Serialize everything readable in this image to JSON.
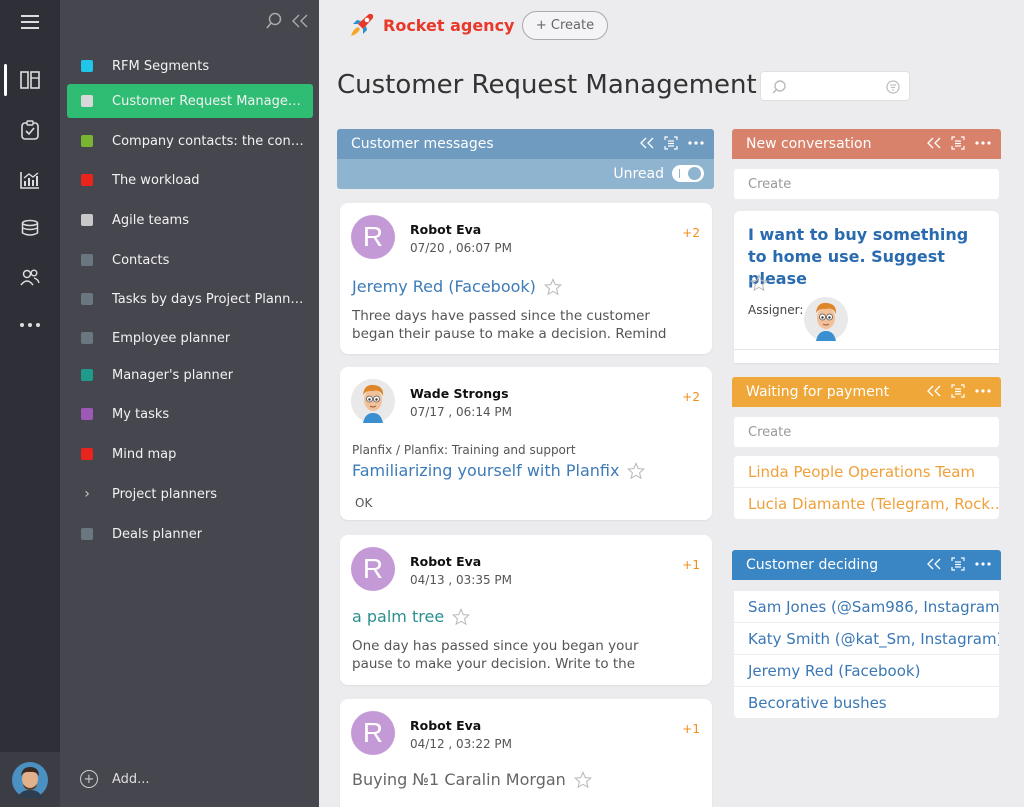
{
  "brand": {
    "name": "Rocket agency",
    "create_label": "+ Create"
  },
  "page": {
    "title": "Customer Request Management"
  },
  "nav": {
    "items": [
      {
        "label": "RFM Segments",
        "color": "#1fc6ea"
      },
      {
        "label": "Customer Request Managem...",
        "color": "#d8d8d8",
        "active": true
      },
      {
        "label": "Company contacts: the contr...",
        "color": "#7ab531"
      },
      {
        "label": "The workload",
        "color": "#e8241c"
      },
      {
        "label": "Agile teams",
        "color": "#c8c8c8"
      },
      {
        "label": "Contacts",
        "color": "#6b7780"
      },
      {
        "label": "Tasks by days Project Planne...",
        "color": "#6b7780"
      },
      {
        "label": "Employee planner",
        "color": "#6b7780"
      },
      {
        "label": "Manager's planner",
        "color": "#1e9b8a"
      },
      {
        "label": "My tasks",
        "color": "#9c59b6"
      },
      {
        "label": "Mind map",
        "color": "#e8241c"
      },
      {
        "label": "Project planners",
        "chevron": true
      },
      {
        "label": "Deals planner",
        "color": "#6b7780"
      }
    ],
    "add_label": "Add..."
  },
  "columns": {
    "messages": {
      "title": "Customer messages",
      "color": "#6e9bbf",
      "unread_label": "Unread",
      "cards": [
        {
          "avatar": "R",
          "who": "Robot Eva",
          "when": "07/20 , 06:07 PM",
          "count": "+2",
          "title": "Jeremy Red (Facebook)",
          "body": "Three days have passed since the customer began their pause to make a decision. Remind"
        },
        {
          "avatar": "",
          "who": "Wade Strongs",
          "when": "07/17 , 06:14 PM",
          "count": "+2",
          "sub": "Planfix / Planfix: Training and support",
          "title": "Familiarizing yourself with Planfix",
          "body": "OK"
        },
        {
          "avatar": "R",
          "who": "Robot Eva",
          "when": "04/13 , 03:35 PM",
          "count": "+1",
          "title": "a palm tree",
          "body": "One day has passed since you began your pause to make your decision. Write to the"
        },
        {
          "avatar": "R",
          "who": "Robot Eva",
          "when": "04/12 , 03:22 PM",
          "count": "+1",
          "title": "Buying №1 Caralin Morgan",
          "body": ""
        }
      ]
    },
    "new_conversation": {
      "title": "New conversation",
      "color": "#d9826b",
      "create_placeholder": "Create",
      "card_title": "I want to buy something to home use. Suggest please",
      "assigner_label": "Assigner:"
    },
    "waiting_payment": {
      "title": "Waiting for payment",
      "color": "#f0a73a",
      "create_placeholder": "Create",
      "items": [
        "Linda People Operations Team",
        "Lucia Diamante (Telegram, Rock..."
      ]
    },
    "customer_deciding": {
      "title": "Customer deciding",
      "color": "#3a86c4",
      "items": [
        "Sam Jones (@Sam986, Instagram)",
        "Katy Smith (@kat_Sm, Instagram)",
        "Jeremy Red (Facebook)",
        "Becorative bushes"
      ]
    }
  }
}
